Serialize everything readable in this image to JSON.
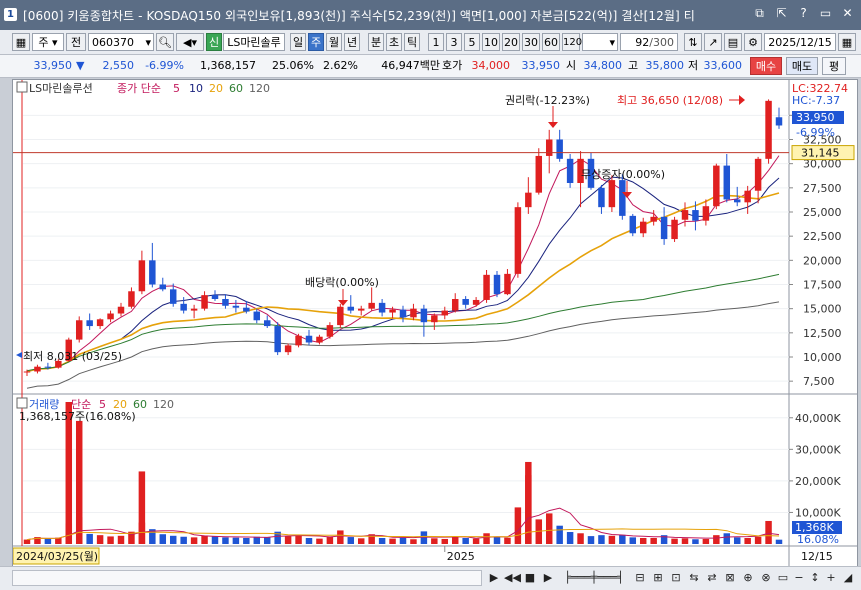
{
  "window": {
    "title": "[0600] 키움종합차트 - KOSDAQ150 외국인보유[1,893(천)] 주식수[52,239(천)] 액면[1,000] 자본금[522(억)] 결산[12월] 티",
    "app_icon": "1",
    "buttons": [
      "⧉",
      "⇱",
      "?",
      "▭",
      "✕"
    ]
  },
  "toolbar": {
    "period_primary": "주",
    "prev_label": "전",
    "stock_code": "060370",
    "new_badge": "신",
    "stock_name": "LS마린솔루",
    "periods": [
      "일",
      "주",
      "월",
      "년",
      "분",
      "초",
      "틱"
    ],
    "active_period": "주",
    "intervals": [
      "1",
      "3",
      "5",
      "10",
      "20",
      "30",
      "60",
      "120"
    ],
    "page_current": "92",
    "page_total": "/300",
    "date": "2025/12/15"
  },
  "quote": {
    "price": "33,950",
    "change_arrow": "▼",
    "change": "2,550",
    "change_pct": "-6.99%",
    "volume": "1,368,157",
    "turnover_pct": "25.06%",
    "ratio": "2.62%",
    "amount": "46,947백만",
    "bid_label": "호가",
    "bid": "34,000",
    "ask": "33,950",
    "open_label": "시",
    "open": "34,800",
    "high_label": "고",
    "high": "35,800",
    "low_label": "저",
    "low": "33,600",
    "buy_label": "매수",
    "sell_label": "매도",
    "avg_label": "평"
  },
  "price_panel": {
    "legend_name": "LS마린솔루션",
    "legend_ma": "종가 단순",
    "ma_periods": [
      "5",
      "10",
      "20",
      "60",
      "120"
    ],
    "ma_colors": [
      "#c2185b",
      "#1a237e",
      "#e6a20a",
      "#2e7d32",
      "#616161"
    ],
    "lc_label": "LC:322.74",
    "hc_label": "HC:-7.37",
    "current_price_tag": "33,950",
    "current_pct_tag": "-6.99%",
    "ref_line_tag": "31,145",
    "y_ticks": [
      "35,000",
      "32,500",
      "30,000",
      "27,500",
      "25,000",
      "22,500",
      "20,000",
      "17,500",
      "15,000",
      "12,500",
      "10,000",
      "7,500"
    ],
    "annotations": {
      "rights": "권리락(-12.23%)",
      "high": "최고 36,650 (12/08)",
      "dividend": "배당락(0.00%)",
      "free_issue": "무상증자(0.00%)",
      "low": "최저 8,031 (03/25)"
    }
  },
  "volume_panel": {
    "legend_name": "거래량",
    "legend_ma": "단순",
    "ma_periods": [
      "5",
      "20",
      "60",
      "120"
    ],
    "value_label": "1,368,157주(16.08%)",
    "y_ticks": [
      "40,000K",
      "30,000K",
      "20,000K",
      "10,000K"
    ],
    "current_tag": "1,368K",
    "current_pct_tag": "16.08%"
  },
  "x_axis": {
    "start_date": "2024/03/25(월)",
    "year_label": "2025",
    "end_label": "12/15"
  },
  "colors": {
    "up": "#e02020",
    "down": "#1f55d4",
    "ref_line": "#c0392b"
  },
  "chart_data": {
    "type": "candlestick",
    "period": "weekly",
    "candles": [
      [
        8400,
        8700,
        8031,
        8500
      ],
      [
        8500,
        9200,
        8300,
        9000
      ],
      [
        9000,
        9400,
        8700,
        8900
      ],
      [
        8900,
        9800,
        8800,
        9600
      ],
      [
        9600,
        12000,
        9500,
        11800
      ],
      [
        11800,
        14200,
        11500,
        13800
      ],
      [
        13800,
        14500,
        12800,
        13200
      ],
      [
        13200,
        14000,
        12900,
        13900
      ],
      [
        13900,
        14800,
        13600,
        14500
      ],
      [
        14500,
        15600,
        14200,
        15200
      ],
      [
        15200,
        17200,
        15000,
        16800
      ],
      [
        16800,
        21000,
        16500,
        20000
      ],
      [
        20000,
        21800,
        17200,
        17500
      ],
      [
        17500,
        18200,
        16800,
        17000
      ],
      [
        17000,
        17600,
        15200,
        15500
      ],
      [
        15500,
        16200,
        14500,
        14800
      ],
      [
        14800,
        15400,
        14000,
        15000
      ],
      [
        15000,
        16800,
        14800,
        16400
      ],
      [
        16400,
        16900,
        15800,
        16000
      ],
      [
        16000,
        16500,
        15000,
        15300
      ],
      [
        15300,
        15900,
        14600,
        15100
      ],
      [
        15100,
        15800,
        14500,
        14700
      ],
      [
        14700,
        15000,
        13500,
        13800
      ],
      [
        13800,
        14300,
        13000,
        13200
      ],
      [
        13200,
        13600,
        10200,
        10500
      ],
      [
        10500,
        11400,
        10200,
        11200
      ],
      [
        11200,
        12400,
        11000,
        12200
      ],
      [
        12200,
        12800,
        11200,
        11500
      ],
      [
        11500,
        12300,
        11300,
        12100
      ],
      [
        12100,
        13600,
        11900,
        13300
      ],
      [
        13300,
        15500,
        13000,
        15200
      ],
      [
        15200,
        16400,
        14500,
        14800
      ],
      [
        14800,
        15300,
        14300,
        15000
      ],
      [
        15000,
        17200,
        14800,
        15600
      ],
      [
        15600,
        16000,
        14200,
        14600
      ],
      [
        14600,
        15200,
        14000,
        14900
      ],
      [
        14900,
        15300,
        13600,
        14100
      ],
      [
        14100,
        15500,
        13800,
        15000
      ],
      [
        15000,
        15400,
        12100,
        13600
      ],
      [
        13600,
        14500,
        12800,
        14300
      ],
      [
        14300,
        15200,
        13900,
        14800
      ],
      [
        14800,
        16600,
        14600,
        16000
      ],
      [
        16000,
        16300,
        15000,
        15400
      ],
      [
        15400,
        16200,
        15200,
        15900
      ],
      [
        15900,
        19000,
        15600,
        18500
      ],
      [
        18500,
        18900,
        16200,
        16500
      ],
      [
        16500,
        19100,
        16400,
        18600
      ],
      [
        18600,
        26000,
        18200,
        25500
      ],
      [
        25500,
        28600,
        24800,
        27000
      ],
      [
        27000,
        31600,
        26800,
        30800
      ],
      [
        30800,
        33500,
        29000,
        32500
      ],
      [
        32500,
        33500,
        30200,
        30500
      ],
      [
        30500,
        31000,
        27500,
        28000
      ],
      [
        28000,
        31300,
        25500,
        30500
      ],
      [
        30500,
        31100,
        27300,
        27500
      ],
      [
        27500,
        27800,
        24800,
        25500
      ],
      [
        25500,
        28800,
        25000,
        28300
      ],
      [
        28300,
        28900,
        24200,
        24600
      ],
      [
        24600,
        24800,
        22500,
        22800
      ],
      [
        22800,
        24400,
        22400,
        24000
      ],
      [
        24000,
        25200,
        23600,
        24500
      ],
      [
        24500,
        25500,
        21600,
        22200
      ],
      [
        22200,
        24500,
        21900,
        24200
      ],
      [
        24200,
        26000,
        23500,
        25200
      ],
      [
        25200,
        26100,
        23100,
        24100
      ],
      [
        24100,
        26300,
        23600,
        25600
      ],
      [
        25600,
        30000,
        25300,
        29800
      ],
      [
        29800,
        31000,
        26000,
        26300
      ],
      [
        26300,
        27600,
        25600,
        26000
      ],
      [
        26000,
        27700,
        24800,
        27200
      ],
      [
        27200,
        30700,
        25900,
        30500
      ],
      [
        30500,
        36650,
        30000,
        36500
      ],
      [
        34800,
        35800,
        33600,
        33950
      ]
    ],
    "volume_k": [
      1400,
      2200,
      1700,
      2000,
      6500,
      8500,
      3200,
      2800,
      2400,
      2600,
      3900,
      6800,
      4700,
      3100,
      2600,
      2300,
      2100,
      2700,
      2400,
      2100,
      2000,
      1900,
      2300,
      2100,
      3900,
      2500,
      2600,
      1900,
      1700,
      2400,
      4300,
      2200,
      1800,
      3100,
      1900,
      1700,
      2000,
      1500,
      4000,
      1800,
      1600,
      2200,
      1900,
      1700,
      3400,
      2300,
      2000,
      11600,
      21800,
      7800,
      9700,
      5800,
      3800,
      3400,
      2500,
      2800,
      2600,
      2900,
      2100,
      1900,
      1900,
      2800,
      1700,
      1800,
      1500,
      1600,
      2800,
      3400,
      2100,
      1900,
      2300,
      7300,
      1368
    ],
    "annotated_volume_spikes_k": [
      45000,
      39000,
      23000,
      26000
    ],
    "price_ylim": [
      7000,
      37000
    ],
    "volume_ylim": [
      0,
      45000
    ],
    "x_start": "2024/03/25",
    "x_end": "2025/12/15"
  }
}
